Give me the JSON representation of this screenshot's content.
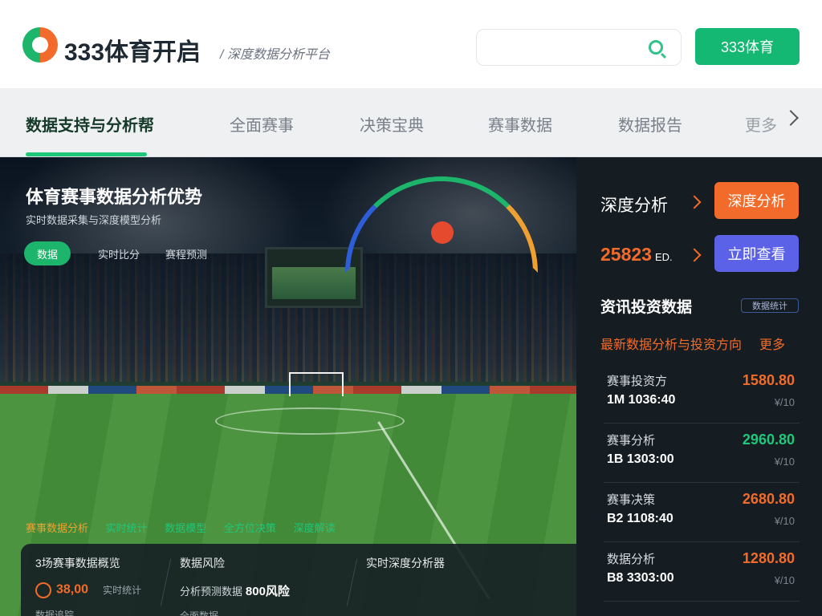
{
  "header": {
    "brand": "333体育开启",
    "tagline": "/ 深度数据分析平台",
    "search_placeholder": "",
    "cta_label": "333体育"
  },
  "tabs": [
    {
      "label": "数据支持与分析帮",
      "active": true
    },
    {
      "label": "全面赛事"
    },
    {
      "label": "决策宝典"
    },
    {
      "label": "赛事数据"
    },
    {
      "label": "数据报告"
    }
  ],
  "tabs_more": "更多",
  "hero": {
    "title": "体育赛事数据分析优势",
    "subtitle": "实时数据采集与深度模型分析",
    "pills": [
      "数据",
      "实时比分",
      "赛程预测"
    ],
    "tags": [
      "赛事数据分析",
      "实时统计",
      "数据模型",
      "全方位决策",
      "深度解读"
    ],
    "panel": {
      "col1_title": "3场赛事数据概览",
      "col1_value": "38,00",
      "col1_unit": "实时统计",
      "col1_footer": "数据追踪",
      "col2_title": "数据风险",
      "col2_value_label": "分析预测数据",
      "col2_value": "800风险",
      "col2_footer": "全面数据",
      "col3_title": "实时深度分析器"
    }
  },
  "sidebar": {
    "analysis_label": "深度分析",
    "analysis_btn": "深度分析",
    "number": "25823",
    "number_unit": "ED.",
    "number_btn": "立即查看",
    "heading": "资讯投资数据",
    "badge": "数据统计",
    "direction": "最新数据分析与投资方向",
    "direction_tag": "更多",
    "rows": [
      {
        "name": "赛事投资方",
        "code": "1M 1036:40",
        "value": "1580.80",
        "trend": "up",
        "unit": "¥/10"
      },
      {
        "name": "赛事分析",
        "code": "1B 1303:00",
        "value": "2960.80",
        "trend": "down",
        "unit": "¥/10"
      },
      {
        "name": "赛事决策",
        "code": "B2 1108:40",
        "value": "2680.80",
        "trend": "up",
        "unit": "¥/10"
      },
      {
        "name": "数据分析",
        "code": "B8 3303:00",
        "value": "1280.80",
        "trend": "up",
        "unit": "¥/10"
      }
    ]
  },
  "colors": {
    "brand_green": "#15b872",
    "accent_orange": "#f26b2a",
    "accent_blue": "#5b62e8",
    "sidebar_bg": "#161d22"
  }
}
